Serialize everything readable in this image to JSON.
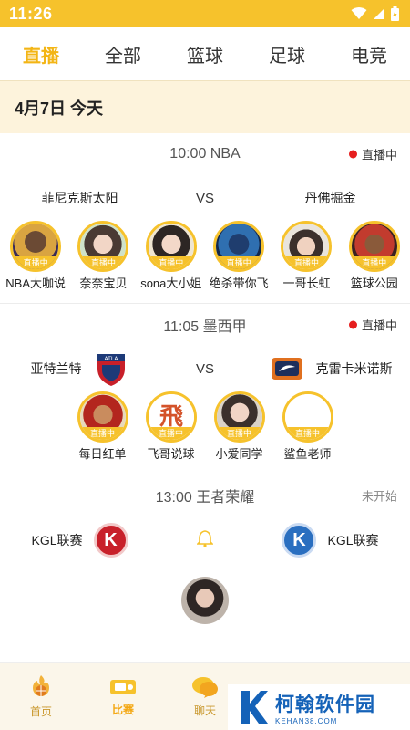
{
  "status": {
    "time": "11:26"
  },
  "tabs": [
    {
      "label": "直播",
      "active": true
    },
    {
      "label": "全部"
    },
    {
      "label": "篮球"
    },
    {
      "label": "足球"
    },
    {
      "label": "电竞"
    }
  ],
  "date": "4月7日  今天",
  "matches": [
    {
      "title": "10:00  NBA",
      "status": "直播中",
      "home": "菲尼克斯太阳",
      "vs": "VS",
      "away": "丹佛掘金",
      "anchors": [
        {
          "name": "NBA大咖说",
          "tag": "直播中"
        },
        {
          "name": "奈奈宝贝",
          "tag": "直播中"
        },
        {
          "name": "sona大小姐",
          "tag": "直播中"
        },
        {
          "name": "绝杀带你飞",
          "tag": "直播中"
        },
        {
          "name": "一哥长虹",
          "tag": "直播中"
        },
        {
          "name": "篮球公园",
          "tag": "直播中"
        }
      ]
    },
    {
      "title": "11:05  墨西甲",
      "status": "直播中",
      "home": "亚特兰特",
      "vs": "VS",
      "away": "克雷卡米诺斯",
      "anchors": [
        {
          "name": "每日红单",
          "tag": "直播中"
        },
        {
          "name": "飞哥说球",
          "tag": "直播中"
        },
        {
          "name": "小爱同学",
          "tag": "直播中"
        },
        {
          "name": "鲨鱼老师",
          "tag": "直播中"
        }
      ]
    },
    {
      "title": "13:00  王者荣耀",
      "status": "未开始",
      "home": "KGL联赛",
      "away": "KGL联赛",
      "home_badge": "K",
      "away_badge": "K"
    }
  ],
  "nav": [
    {
      "label": "首页",
      "icon": "basketball-flame-icon"
    },
    {
      "label": "比赛",
      "icon": "ticket-icon",
      "active": true
    },
    {
      "label": "聊天",
      "icon": "chat-bubble-icon"
    },
    {
      "label": "",
      "icon": "crown-icon"
    },
    {
      "label": "",
      "icon": "profile-icon"
    }
  ],
  "watermark": {
    "main": "柯翰软件园",
    "sub": "KEHAN38.COM"
  },
  "colors": {
    "accent": "#f6c22c",
    "live_dot": "#e61e1e",
    "active_tab": "#f3b515"
  }
}
